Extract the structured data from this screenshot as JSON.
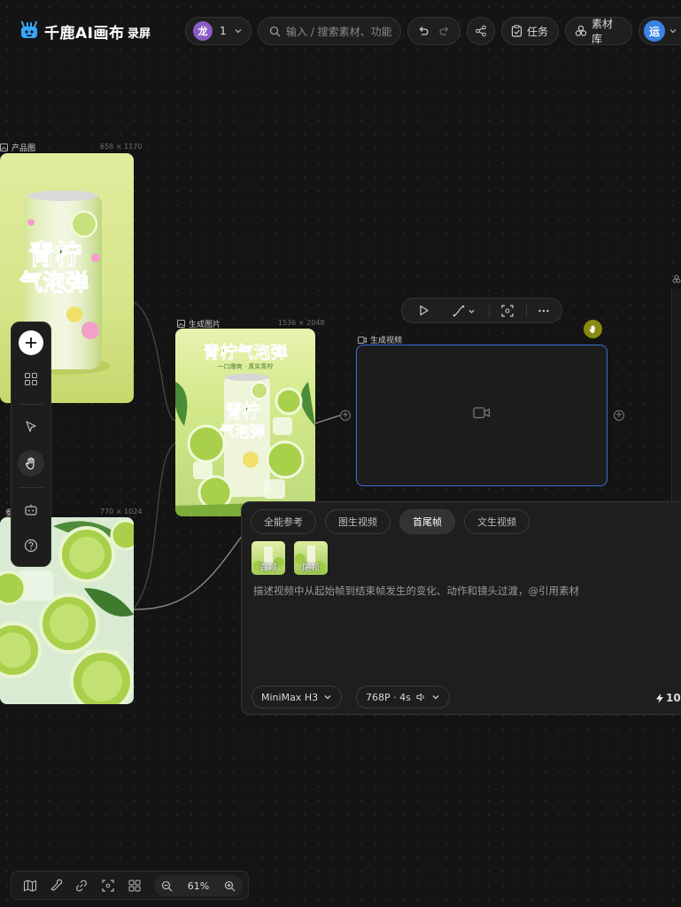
{
  "header": {
    "logo_text": "千鹿AI画布",
    "record_label": "录屏",
    "user_count": "1",
    "user_avatar_text": "龙",
    "search_placeholder": "输入 / 搜索素材、功能",
    "task_label": "任务",
    "assets_label": "素材库",
    "account_avatar_text": "运"
  },
  "nodes": {
    "product": {
      "label": "产品图",
      "size": "658 × 1170"
    },
    "generated_image": {
      "label": "生成图片",
      "size": "1536 × 2048"
    },
    "generated_video": {
      "label": "生成视频"
    },
    "bottom_image": {
      "label": "参",
      "size": "770 × 1024"
    }
  },
  "posters": {
    "can_title_line1": "青柠",
    "can_title_line2": "气泡弹",
    "poster_title": "青柠气泡弹",
    "poster_subtitle": "一口爆爽 · 真实青柠"
  },
  "panel": {
    "tabs": [
      {
        "label": "全能参考",
        "active": false
      },
      {
        "label": "图生视频",
        "active": false
      },
      {
        "label": "首尾帧",
        "active": true
      },
      {
        "label": "文生视频",
        "active": false
      }
    ],
    "first_frame_label": "首帧",
    "last_frame_label": "尾帧",
    "description_placeholder": "描述视频中从起始帧到结束帧发生的变化、动作和镜头过渡，@引用素材",
    "model": "MiniMax H3",
    "resolution": "768P · 4s",
    "credits": "10"
  },
  "zoom": {
    "level": "61%"
  },
  "colors": {
    "accent_blue": "#3d6fd6",
    "lime": "#b7d84a",
    "cursor": "#8a8a10"
  }
}
